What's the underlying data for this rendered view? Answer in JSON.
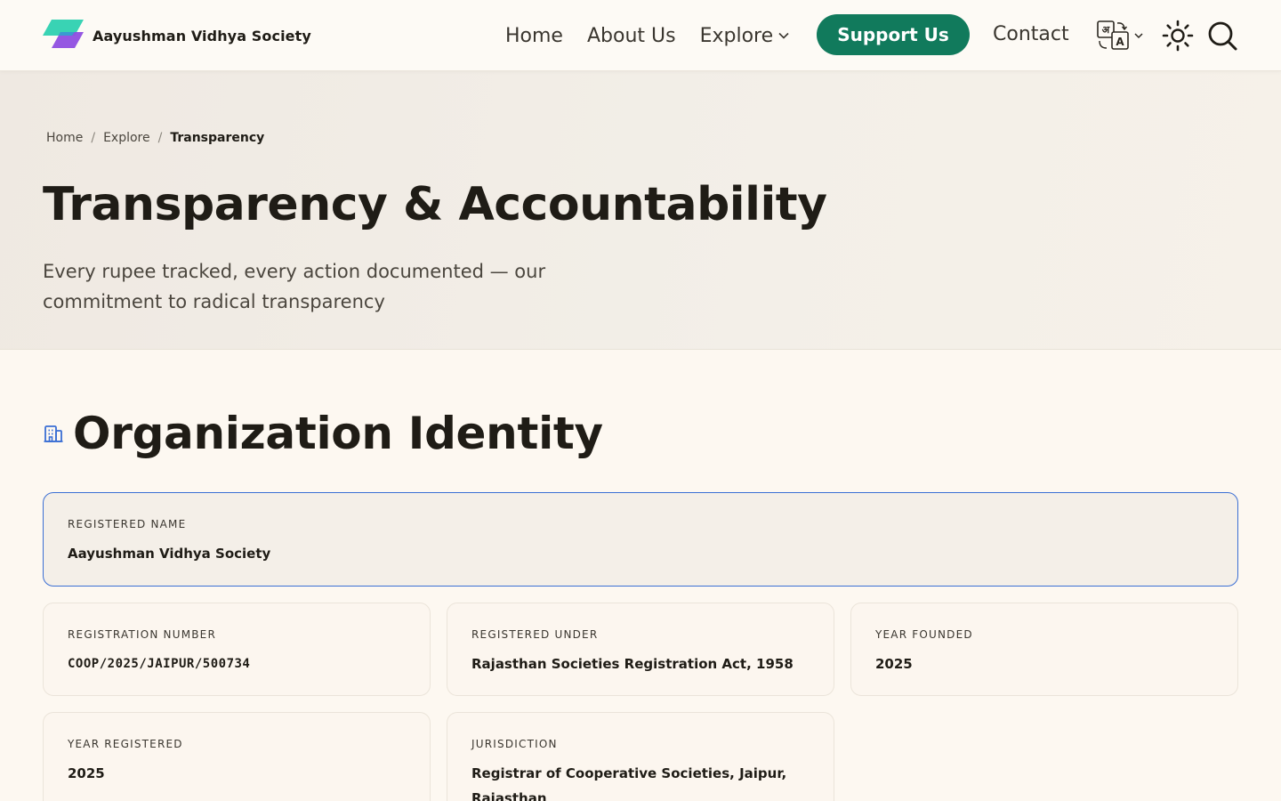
{
  "brand": {
    "name": "Aayushman Vidhya Society",
    "colors": {
      "teal": "#39d3b4",
      "purple": "#8f4ee0"
    }
  },
  "nav": {
    "home": "Home",
    "about": "About Us",
    "explore": "Explore",
    "support": "Support Us",
    "contact": "Contact",
    "accent_color": "#117a5c",
    "icons": [
      "translate-icon",
      "sun-icon",
      "search-icon"
    ]
  },
  "breadcrumb": {
    "items": [
      "Home",
      "Explore"
    ],
    "current": "Transparency"
  },
  "hero": {
    "title": "Transparency & Accountability",
    "subtitle": "Every rupee tracked, every action documented — our commitment to radical transparency"
  },
  "section": {
    "title": "Organization Identity",
    "icon": "building-icon",
    "icon_color": "#3b6fd4"
  },
  "cards": [
    {
      "label": "Registered Name",
      "value": "Aayushman Vidhya Society"
    },
    {
      "label": "Registration Number",
      "value": "COOP/2025/JAIPUR/500734"
    },
    {
      "label": "Registered Under",
      "value": "Rajasthan Societies Registration Act, 1958"
    },
    {
      "label": "Year Founded",
      "value": "2025"
    },
    {
      "label": "Year Registered",
      "value": "2025"
    },
    {
      "label": "Jurisdiction",
      "value": "Registrar of Cooperative Societies, Jaipur, Rajasthan"
    }
  ]
}
